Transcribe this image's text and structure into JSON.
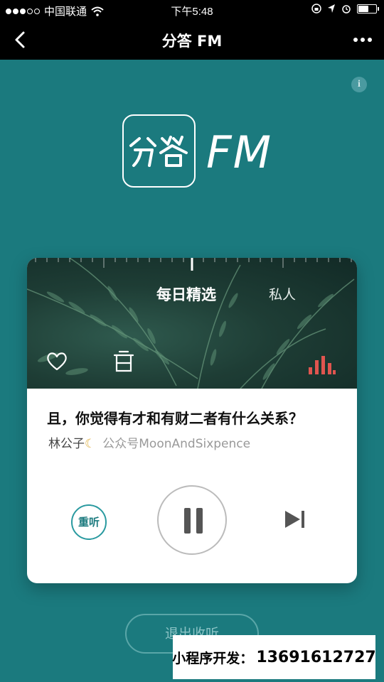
{
  "status_bar": {
    "carrier": "中国联通",
    "time": "下午5:48"
  },
  "nav": {
    "title": "分答 FM"
  },
  "logo": {
    "brand_text": "分答",
    "fm_text": "FM"
  },
  "info": {
    "label": "i"
  },
  "card": {
    "tabs": [
      {
        "label": "每日精选",
        "active": true
      },
      {
        "label": "私人",
        "active": false
      }
    ],
    "track": {
      "title": "且，你觉得有才和有财二者有什么关系？",
      "author": "林公子",
      "source": "公众号MoonAndSixpence"
    },
    "controls": {
      "replay_label": "重听"
    }
  },
  "exit_button": {
    "label": "退出收听"
  },
  "ad_banner": {
    "label": "小程序开发：",
    "phone": "13691612727"
  },
  "colors": {
    "background": "#1b7a7e",
    "accent": "#2a9aa0",
    "equalizer": "#e0554f"
  },
  "icons": [
    "back-icon",
    "more-icon",
    "info-icon",
    "heart-icon",
    "trash-icon",
    "equalizer-icon",
    "pause-icon",
    "next-icon",
    "wifi-icon",
    "battery-icon"
  ]
}
